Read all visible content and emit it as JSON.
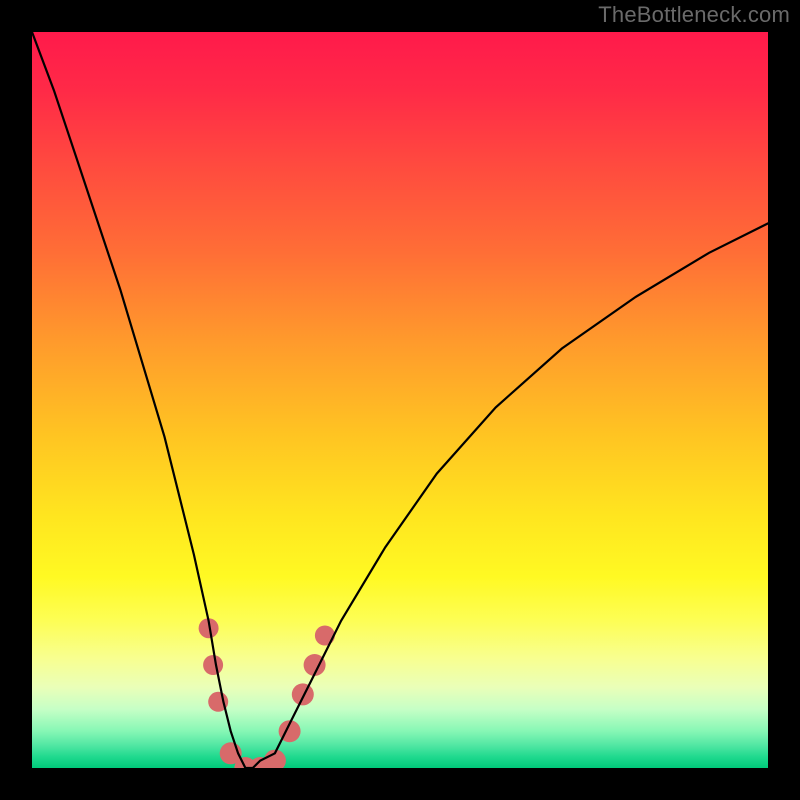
{
  "watermark": "TheBottleneck.com",
  "chart_data": {
    "type": "line",
    "title": "",
    "xlabel": "",
    "ylabel": "",
    "xlim": [
      0,
      100
    ],
    "ylim": [
      0,
      100
    ],
    "background_gradient": {
      "top": "#ff1a4b",
      "mid": "#ffe61f",
      "bottom": "#00c97a"
    },
    "series": [
      {
        "name": "bottleneck-curve",
        "x": [
          0,
          3,
          6,
          9,
          12,
          15,
          18,
          20,
          22,
          24,
          25,
          26,
          27,
          28,
          29,
          30,
          31,
          33,
          35,
          38,
          42,
          48,
          55,
          63,
          72,
          82,
          92,
          100
        ],
        "y": [
          100,
          92,
          83,
          74,
          65,
          55,
          45,
          37,
          29,
          20,
          14,
          9,
          5,
          2,
          0,
          0,
          1,
          2,
          6,
          12,
          20,
          30,
          40,
          49,
          57,
          64,
          70,
          74
        ],
        "color": "#000000"
      }
    ],
    "markers": [
      {
        "name": "left-cluster-1",
        "x": 24.0,
        "y": 19,
        "color": "#d86a6a",
        "r": 10
      },
      {
        "name": "left-cluster-2",
        "x": 24.6,
        "y": 14,
        "color": "#d86a6a",
        "r": 10
      },
      {
        "name": "left-cluster-3",
        "x": 25.3,
        "y": 9,
        "color": "#d86a6a",
        "r": 10
      },
      {
        "name": "bottom-1",
        "x": 27.0,
        "y": 2,
        "color": "#d86a6a",
        "r": 11
      },
      {
        "name": "bottom-2",
        "x": 29.0,
        "y": 0,
        "color": "#d86a6a",
        "r": 11
      },
      {
        "name": "bottom-3",
        "x": 31.0,
        "y": 0,
        "color": "#d86a6a",
        "r": 11
      },
      {
        "name": "bottom-4",
        "x": 33.0,
        "y": 1,
        "color": "#d86a6a",
        "r": 11
      },
      {
        "name": "right-cluster-1",
        "x": 35.0,
        "y": 5,
        "color": "#d86a6a",
        "r": 11
      },
      {
        "name": "right-cluster-2",
        "x": 36.8,
        "y": 10,
        "color": "#d86a6a",
        "r": 11
      },
      {
        "name": "right-cluster-3",
        "x": 38.4,
        "y": 14,
        "color": "#d86a6a",
        "r": 11
      },
      {
        "name": "right-cluster-4",
        "x": 39.8,
        "y": 18,
        "color": "#d86a6a",
        "r": 10
      }
    ]
  }
}
